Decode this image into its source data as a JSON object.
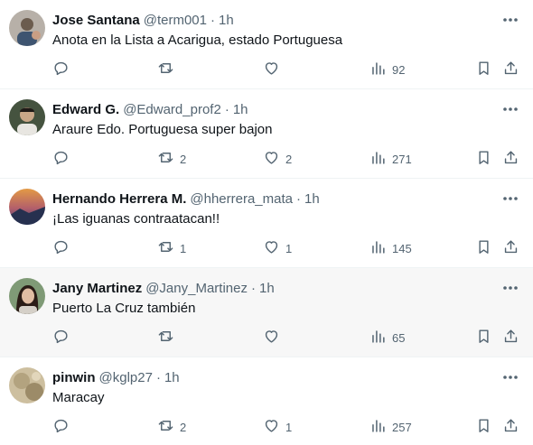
{
  "tweets": [
    {
      "name": "Jose Santana",
      "handle": "@term001",
      "time": "1h",
      "text": "Anota en la Lista a Acarigua, estado Portuguesa",
      "replies": "",
      "retweets": "",
      "likes": "",
      "views": "92",
      "avatar_colors": [
        "#9c8e7f",
        "#4a4038"
      ]
    },
    {
      "name": "Edward G.",
      "handle": "@Edward_prof2",
      "time": "1h",
      "text": "Araure Edo. Portuguesa super bajon",
      "replies": "",
      "retweets": "2",
      "likes": "2",
      "views": "271",
      "avatar_colors": [
        "#3d4a3a",
        "#c9a788"
      ]
    },
    {
      "name": "Hernando Herrera M.",
      "handle": "@hherrera_mata",
      "time": "1h",
      "text": "¡Las iguanas contraatacan!!",
      "replies": "",
      "retweets": "1",
      "likes": "1",
      "views": "145",
      "avatar_colors": [
        "#d98a3a",
        "#3b4f8c"
      ]
    },
    {
      "name": "Jany Martinez",
      "handle": "@Jany_Martinez",
      "time": "1h",
      "text": "Puerto La Cruz también",
      "replies": "",
      "retweets": "",
      "likes": "",
      "views": "65",
      "avatar_colors": [
        "#6e8c6a",
        "#d8b39a"
      ]
    },
    {
      "name": "pinwin",
      "handle": "@kglp27",
      "time": "1h",
      "text": "Maracay",
      "replies": "",
      "retweets": "2",
      "likes": "1",
      "views": "257",
      "avatar_colors": [
        "#c8b898",
        "#8a7a5c"
      ]
    }
  ],
  "colors": {
    "text": "#0f1419",
    "secondary": "#536471",
    "highlight_bg": "#f7f7f7",
    "divider": "#eff3f4"
  },
  "icons": [
    "reply-icon",
    "retweet-icon",
    "like-icon",
    "views-icon",
    "bookmark-icon",
    "share-icon",
    "more-icon"
  ]
}
